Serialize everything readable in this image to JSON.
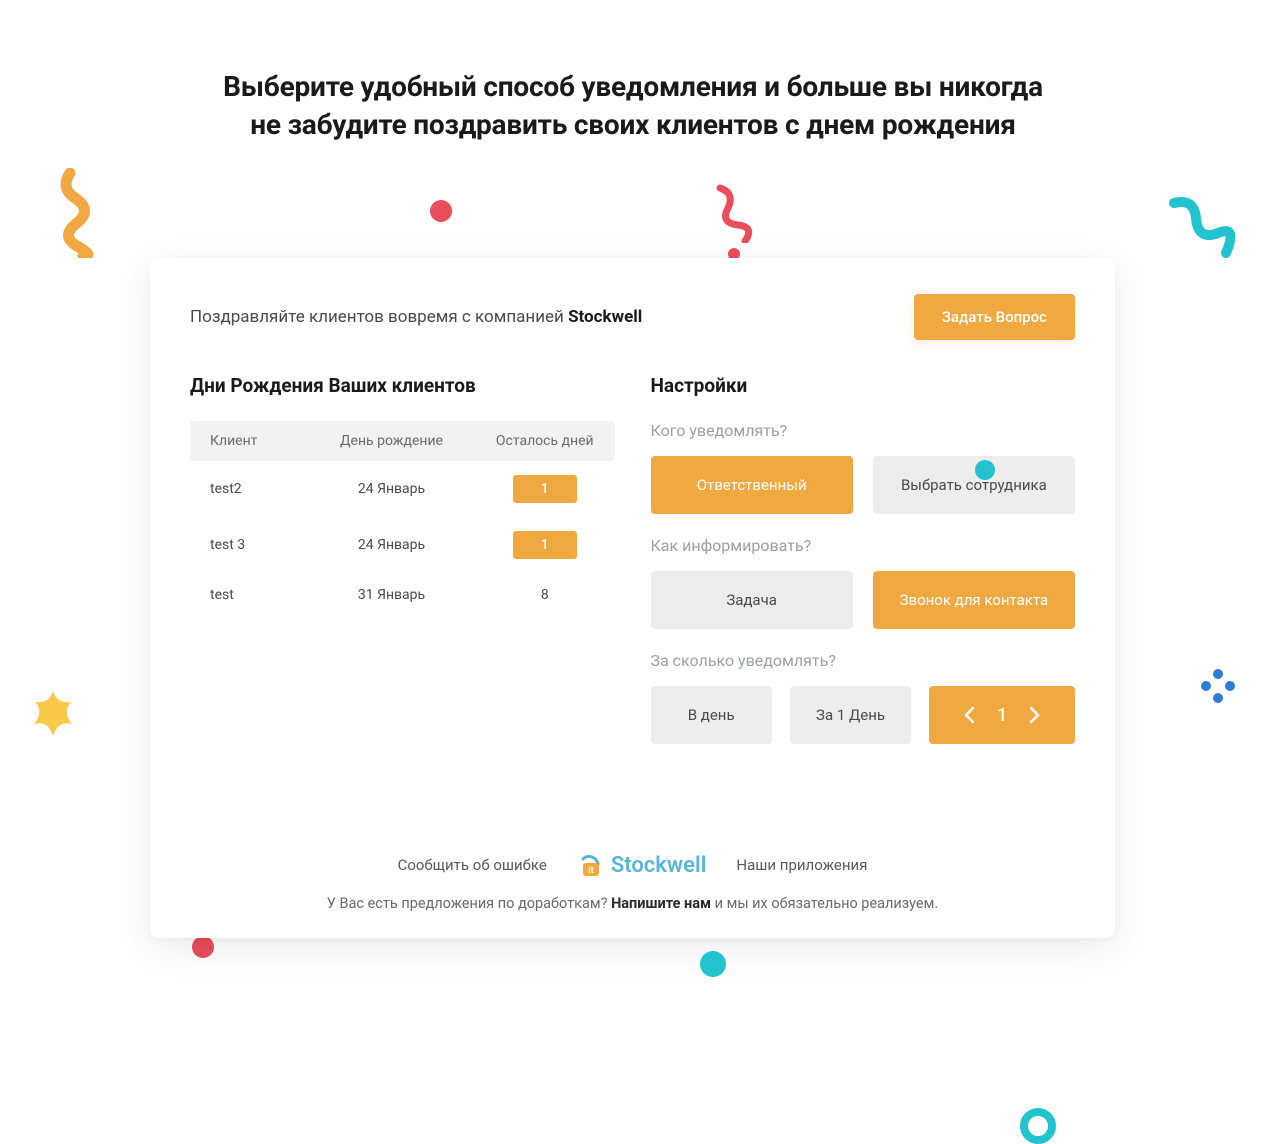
{
  "heading_line1": "Выберите удобный способ уведомления и больше вы никогда",
  "heading_line2": "не забудите поздравить своих клиентов с днем рождения",
  "tagline_prefix": "Поздравляйте клиентов вовремя с компанией ",
  "tagline_brand": "Stockwell",
  "ask_button": "Задать Вопрос",
  "left": {
    "title": "Дни Рождения Ваших клиентов",
    "th_client": "Клиент",
    "th_bday": "День рождение",
    "th_days": "Осталось дней",
    "rows": [
      {
        "client": "test2",
        "bday": "24 Январь",
        "days": "1",
        "highlight": true
      },
      {
        "client": "test 3",
        "bday": "24 Январь",
        "days": "1",
        "highlight": true
      },
      {
        "client": "test",
        "bday": "31 Январь",
        "days": "8",
        "highlight": false
      }
    ]
  },
  "right": {
    "title": "Настройки",
    "who_label": "Кого уведомлять?",
    "who_opts": [
      "Ответственный",
      "Выбрать сотрудника"
    ],
    "who_active": 0,
    "how_label": "Как информировать?",
    "how_opts": [
      "Задача",
      "Звонок для контакта"
    ],
    "how_active": 1,
    "when_label": "За сколько уведомлять?",
    "when_opts": [
      "В день",
      "За 1 День"
    ],
    "stepper_value": "1"
  },
  "footer": {
    "report": "Сообщить об ошибке",
    "brand": "Stockwell",
    "apps": "Наши приложения",
    "bottom_prefix": "У Вас есть предложения по доработкам? ",
    "bottom_link": "Напишите нам",
    "bottom_suffix": " и мы их обязательно реализуем."
  }
}
